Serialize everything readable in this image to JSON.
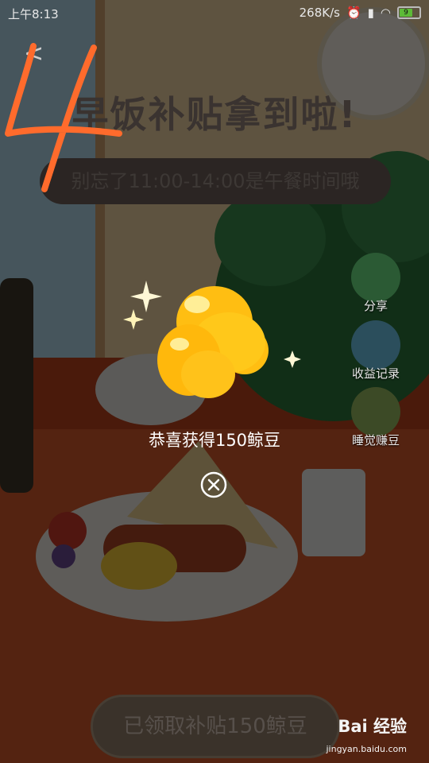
{
  "status_bar": {
    "time": "上午8:13",
    "speed": "268K/s",
    "battery": "9"
  },
  "header": {
    "back_glyph": "<",
    "title": "早饭补贴拿到啦!",
    "subtitle": "别忘了11:00-14:00是午餐时间哦"
  },
  "side_actions": [
    {
      "label": "分享",
      "icon": "share-icon"
    },
    {
      "label": "收益记录",
      "icon": "record-icon"
    },
    {
      "label": "睡觉赚豆",
      "icon": "sleep-icon"
    }
  ],
  "popup": {
    "message": "恭喜获得150鲸豆",
    "reward_icon": "bean-icon",
    "close_icon": "close-icon"
  },
  "footer": {
    "button_label": "已领取补贴150鲸豆"
  },
  "watermark": {
    "brand": "Bai 经验",
    "url": "jingyan.baidu.com"
  },
  "annotation": {
    "mark": "4"
  },
  "colors": {
    "accent": "#ff6b2c",
    "bean": "#ffc40f"
  }
}
